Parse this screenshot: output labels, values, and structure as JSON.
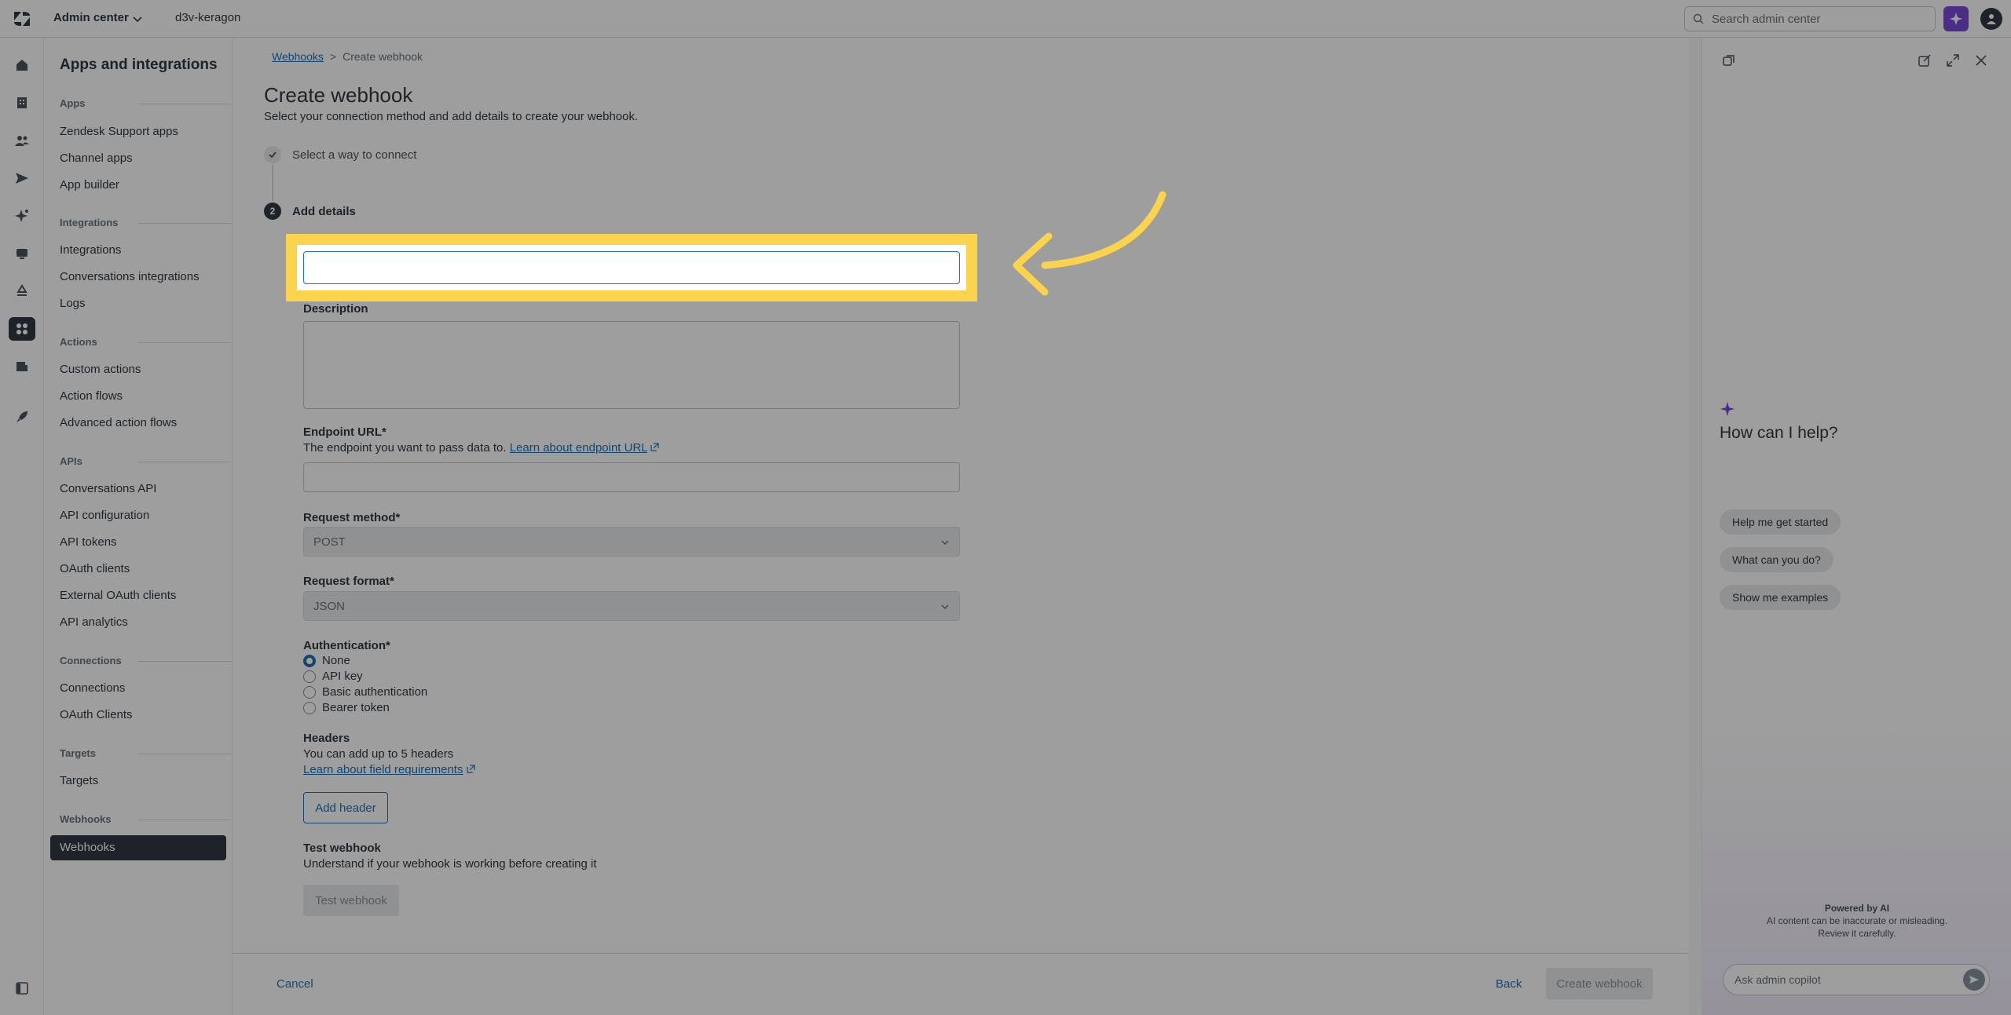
{
  "topbar": {
    "product_label": "Admin center",
    "subdomain": "d3v-keragon",
    "search_placeholder": "Search admin center",
    "accent": "#7a4ad9"
  },
  "rail": {
    "items": [
      "home-icon",
      "building-icon",
      "people-icon",
      "send-icon",
      "sparkle-icon",
      "monitor-icon",
      "recycle-icon",
      "apps-icon",
      "database-icon",
      "rocket-icon"
    ],
    "active": "apps-icon",
    "bottom": "sidebar-toggle-icon"
  },
  "sidenav": {
    "title": "Apps and integrations",
    "sections": [
      {
        "heading": "Apps",
        "items": [
          "Zendesk Support apps",
          "Channel apps",
          "App builder"
        ]
      },
      {
        "heading": "Integrations",
        "items": [
          "Integrations",
          "Conversations integrations",
          "Logs"
        ]
      },
      {
        "heading": "Actions",
        "items": [
          "Custom actions",
          "Action flows",
          "Advanced action flows"
        ]
      },
      {
        "heading": "APIs",
        "items": [
          "Conversations API",
          "API configuration",
          "API tokens",
          "OAuth clients",
          "External OAuth clients",
          "API analytics"
        ]
      },
      {
        "heading": "Connections",
        "items": [
          "Connections",
          "OAuth Clients"
        ]
      },
      {
        "heading": "Targets",
        "items": [
          "Targets"
        ]
      },
      {
        "heading": "Webhooks",
        "items": [
          "Webhooks"
        ]
      }
    ],
    "active_item": "Webhooks"
  },
  "main": {
    "breadcrumb": {
      "link": "Webhooks",
      "separator": ">",
      "current": "Create webhook"
    },
    "title": "Create webhook",
    "description": "Select your connection method and add details to create your webhook.",
    "steps": [
      {
        "number": "",
        "label": "Select a way to connect",
        "status": "complete"
      },
      {
        "number": "2",
        "label": "Add details",
        "status": "current"
      }
    ],
    "name_field": {
      "value": "",
      "placeholder": ""
    },
    "description_label": "Description",
    "endpoint": {
      "label": "Endpoint URL*",
      "hint": "The endpoint you want to pass data to.",
      "link": "Learn about endpoint URL"
    },
    "request_method": {
      "label": "Request method*",
      "value": "POST"
    },
    "request_format": {
      "label": "Request format*",
      "value": "JSON"
    },
    "authentication": {
      "label": "Authentication*",
      "options": [
        "None",
        "API key",
        "Basic authentication",
        "Bearer token"
      ],
      "selected": "None"
    },
    "headers": {
      "label": "Headers",
      "hint": "You can add up to 5 headers",
      "link": "Learn about field requirements",
      "button": "Add header"
    },
    "test": {
      "label": "Test webhook",
      "hint": "Understand if your webhook is working before creating it",
      "button": "Test webhook"
    },
    "footer": {
      "cancel": "Cancel",
      "back": "Back",
      "create": "Create webhook"
    }
  },
  "copilot": {
    "greeting": "How can I help?",
    "suggestions": [
      "Help me get started",
      "What can you do?",
      "Show me examples"
    ],
    "powered_by": "Powered by AI",
    "disclaimer_1": "AI content can be inaccurate or misleading.",
    "disclaimer_2": "Review it carefully.",
    "input_placeholder": "Ask admin copilot"
  },
  "annotation": {
    "highlight_color": "#fcd34d"
  }
}
